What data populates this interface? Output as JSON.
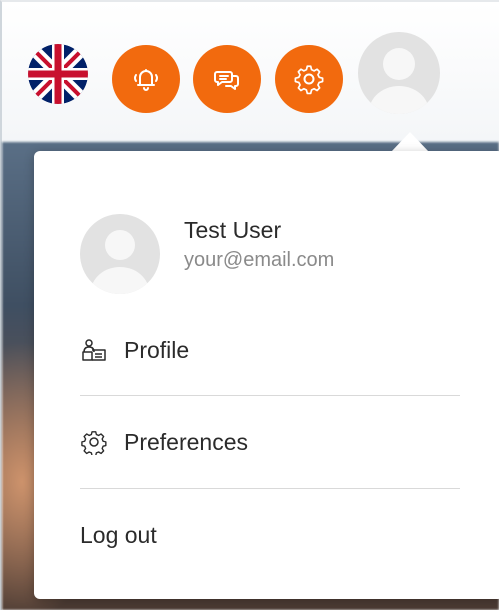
{
  "header": {
    "language": {
      "icon": "uk-flag-icon"
    },
    "buttons": [
      {
        "name": "notifications-button",
        "icon": "bell-icon"
      },
      {
        "name": "messages-button",
        "icon": "chat-bubbles-icon"
      },
      {
        "name": "settings-button",
        "icon": "gear-icon"
      }
    ],
    "accent_color": "#f26a0e",
    "avatar": {
      "icon": "user-avatar-icon"
    }
  },
  "user_menu": {
    "user": {
      "name": "Test User",
      "email": "your@email.com"
    },
    "items": [
      {
        "label": "Profile",
        "icon": "profile-card-icon"
      },
      {
        "label": "Preferences",
        "icon": "gear-outline-icon"
      },
      {
        "label": "Log out"
      }
    ]
  }
}
